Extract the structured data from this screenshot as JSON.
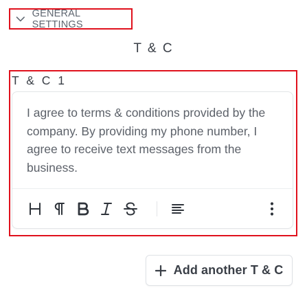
{
  "settings_toggle": {
    "label": "GENERAL SETTINGS",
    "icon": "chevron-down-icon"
  },
  "section": {
    "title": "T & C"
  },
  "terms": [
    {
      "label": "T & C 1",
      "text": "I agree to terms & conditions provided by the company. By providing my phone number, I agree to receive text messages from the business."
    }
  ],
  "toolbar": {
    "buttons": [
      {
        "name": "heading-icon",
        "glyph": "H"
      },
      {
        "name": "paragraph-icon",
        "glyph": "¶"
      },
      {
        "name": "bold-icon",
        "glyph": "B"
      },
      {
        "name": "italic-icon",
        "glyph": "I"
      },
      {
        "name": "strikethrough-icon",
        "glyph": "S"
      },
      {
        "name": "align-left-icon",
        "glyph": ""
      },
      {
        "name": "more-vertical-icon",
        "glyph": ""
      }
    ]
  },
  "add_button": {
    "label": "Add another T & C",
    "icon": "plus-icon"
  },
  "colors": {
    "highlight_border": "#e0101c",
    "text_primary": "#3a3f47",
    "text_body": "#5c6169"
  }
}
